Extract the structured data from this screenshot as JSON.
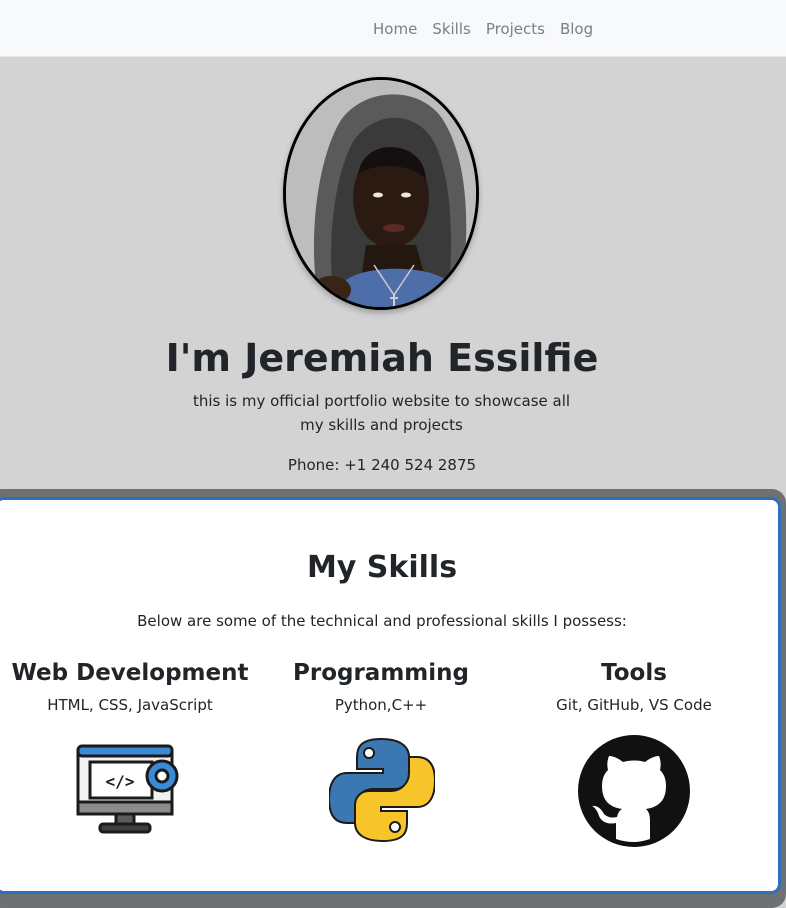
{
  "nav": {
    "items": [
      {
        "label": "Home"
      },
      {
        "label": "Skills"
      },
      {
        "label": "Projects"
      },
      {
        "label": "Blog"
      }
    ]
  },
  "hero": {
    "title": "I'm Jeremiah Essilfie",
    "subtitle": "this is my official portfolio website to showcase all my skills and projects",
    "phone": "Phone: +1 240 524 2875",
    "avatar_icon": "profile-photo"
  },
  "skills": {
    "title": "My Skills",
    "intro": "Below are some of the technical and professional skills I possess:",
    "items": [
      {
        "name": "Web Development",
        "desc": "HTML, CSS, JavaScript",
        "icon": "web-development-icon"
      },
      {
        "name": "Programming",
        "desc": "Python,C++",
        "icon": "python-icon"
      },
      {
        "name": "Tools",
        "desc": "Git, GitHub, VS Code",
        "icon": "github-icon"
      }
    ]
  },
  "colors": {
    "nav_bg": "#f8f9fa",
    "hero_bg": "#d3d3d3",
    "card_border": "#2f6fc0",
    "frame": "#6e7174",
    "text": "#212529"
  }
}
